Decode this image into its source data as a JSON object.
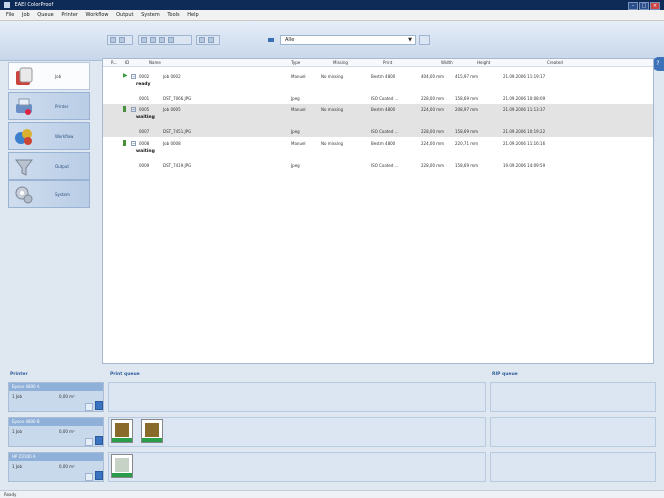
{
  "window": {
    "title": "EAEI ColorProof"
  },
  "menu": [
    "File",
    "Job",
    "Queue",
    "Printer",
    "Workflow",
    "Output",
    "System",
    "Tools",
    "Help"
  ],
  "toolbar": {
    "filter_value": "Alle"
  },
  "nav": [
    "Job",
    "Printer",
    "Workflow",
    "Output",
    "System"
  ],
  "columns": {
    "expand": "R...",
    "id": "ID",
    "name": "Name",
    "type": "Type",
    "missing": "Missing",
    "print": "Print",
    "width": "Width",
    "height": "Height",
    "created": "Created"
  },
  "jobs": [
    {
      "id": "0002",
      "name": "Job 0002",
      "type": "Manuel",
      "missing": "No missing",
      "print": "Bestm 4800",
      "width": "404,00 mm",
      "height": "415,97 mm",
      "created": "21.09.2006 11:19:17",
      "status": "ready"
    },
    {
      "id": "0001",
      "name": "DST_7066.JPG",
      "type": "Jpeg",
      "missing": "",
      "print": "ISO Coated ...",
      "width": "228,00 mm",
      "height": "158,69 mm",
      "created": "21.09.2006 10:08:09",
      "status": ""
    },
    {
      "id": "0005",
      "name": "Job 0005",
      "type": "Manuel",
      "missing": "No missing",
      "print": "Bestm 4800",
      "width": "224,00 mm",
      "height": "208,97 mm",
      "created": "21.09.2006 11:13:37",
      "status": "waiting"
    },
    {
      "id": "0007",
      "name": "DST_7451.JPG",
      "type": "Jpeg",
      "missing": "",
      "print": "ISO Coated ...",
      "width": "228,00 mm",
      "height": "158,69 mm",
      "created": "21.09.2006 10:19:22",
      "status": ""
    },
    {
      "id": "0008",
      "name": "Job 0008",
      "type": "Manuel",
      "missing": "No missing",
      "print": "Bestm 4800",
      "width": "224,00 mm",
      "height": "220,71 mm",
      "created": "21.09.2006 11:16:16",
      "status": "waiting"
    },
    {
      "id": "0009",
      "name": "DST_7419.JPG",
      "type": "Jpeg",
      "missing": "",
      "print": "ISO Coated ...",
      "width": "228,00 mm",
      "height": "158,69 mm",
      "created": "19.09.2006 14:09:59",
      "status": ""
    }
  ],
  "queues": {
    "printer": "Printer",
    "print": "Print queue",
    "rip": "RIP queue"
  },
  "printers": [
    {
      "name": "Epson 4800 A",
      "left": "1 Job",
      "right": "0,00 m²"
    },
    {
      "name": "Epson 4800 B",
      "left": "1 Job",
      "right": "0,00 m²"
    },
    {
      "name": "HP Z3100 A",
      "left": "1 Job",
      "right": "0,00 m²"
    }
  ],
  "status": "Ready"
}
